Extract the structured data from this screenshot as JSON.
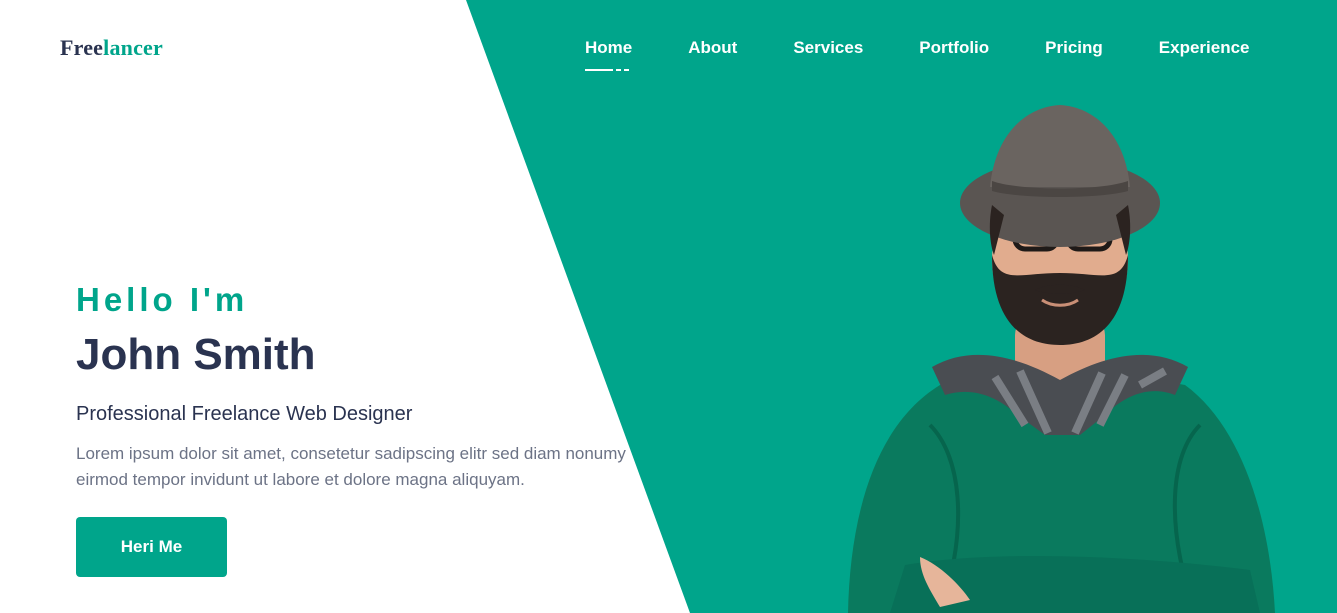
{
  "brand": {
    "logo_part1": "Free",
    "logo_part2": "lancer"
  },
  "nav": {
    "items": [
      {
        "label": "Home",
        "active": true
      },
      {
        "label": "About",
        "active": false
      },
      {
        "label": "Services",
        "active": false
      },
      {
        "label": "Portfolio",
        "active": false
      },
      {
        "label": "Pricing",
        "active": false
      },
      {
        "label": "Experience",
        "active": false
      }
    ]
  },
  "hero": {
    "greeting": "Hello I'm",
    "name": "John Smith",
    "role": "Professional Freelance Web Designer",
    "description": "Lorem ipsum dolor sit amet, consetetur sadipscing elitr sed diam nonumy eirmod tempor invidunt ut labore et dolore magna aliquyam.",
    "cta_label": "Heri Me"
  },
  "colors": {
    "accent": "#00a58b",
    "heading": "#2a3350",
    "body_text": "#6c7386",
    "nav_text": "#ffffff"
  }
}
